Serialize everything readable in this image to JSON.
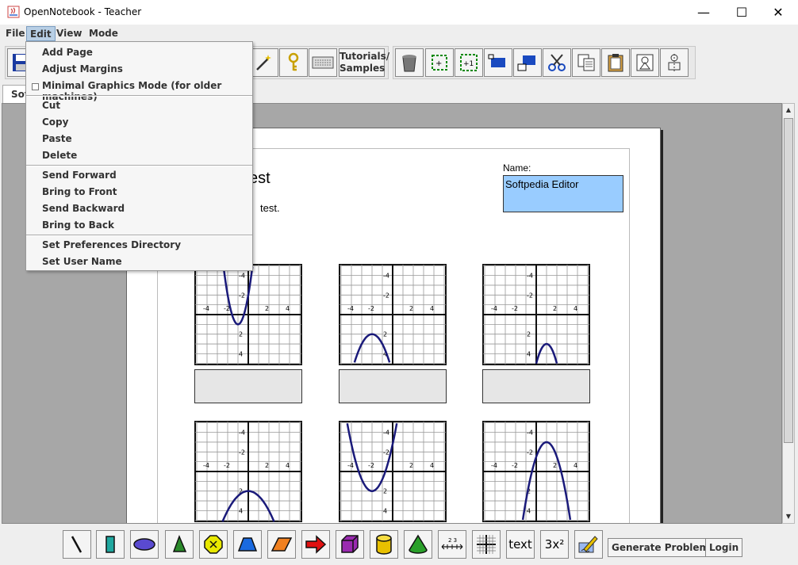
{
  "window": {
    "title": "OpenNotebook - Teacher",
    "minimize_glyph": "—",
    "maximize_glyph": "☐",
    "close_glyph": "✕"
  },
  "menubar": {
    "items": [
      "File",
      "Edit",
      "View",
      "Mode"
    ]
  },
  "edit_menu": {
    "items": [
      "Add Page",
      "Adjust Margins",
      "Minimal Graphics Mode (for older machines)",
      "Cut",
      "Copy",
      "Paste",
      "Delete",
      "Send Forward",
      "Bring to Front",
      "Send Backward",
      "Bring to Back",
      "Set Preferences Directory",
      "Set User Name"
    ]
  },
  "toolbar": {
    "tutorials_line1": "Tutorials/",
    "tutorials_line2": "Samples",
    "icons": [
      "save-icon",
      "magic-wand-icon",
      "key-icon",
      "keyboard-icon",
      "trash-icon",
      "group-icon",
      "ungroup-icon",
      "move-up-icon",
      "move-down-icon",
      "scissors-icon",
      "copy-icon",
      "clipboard-icon",
      "duplicate-icon",
      "align-icon"
    ]
  },
  "tab": {
    "label": "Sof"
  },
  "document": {
    "title_fragment": "est",
    "instruction_fragment": "test.",
    "name_label": "Name:",
    "name_value": "Softpedia Editor",
    "axis_ticks": [
      "-4",
      "-2",
      "2",
      "4"
    ]
  },
  "bottombar": {
    "text_tool": "text",
    "exponent_tool": "3x²",
    "generate_label": "Generate Problems",
    "login_label": "Login",
    "tick_label": "2 3"
  },
  "colors": {
    "name_box": "#99ccff",
    "curve": "#1a1a7a",
    "menu_highlight": "#b8cfe5"
  }
}
